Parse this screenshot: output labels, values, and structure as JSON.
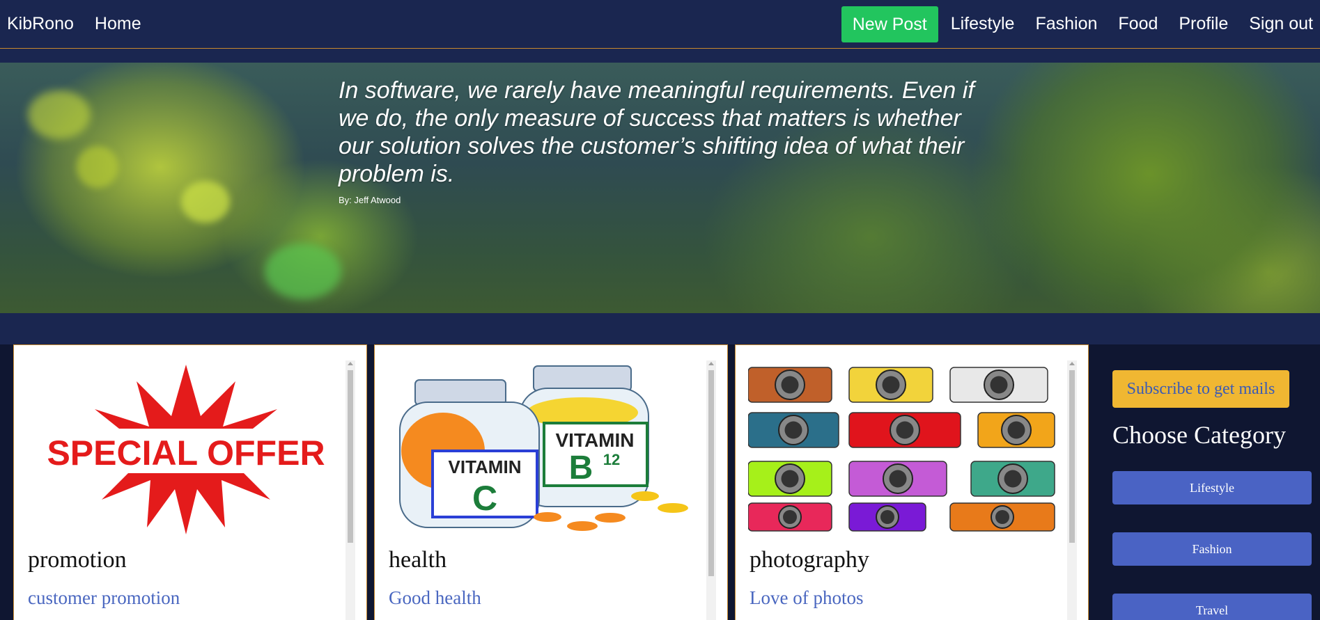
{
  "nav": {
    "brand": "KibRono",
    "home": "Home",
    "new_post": "New Post",
    "links": [
      "Lifestyle",
      "Fashion",
      "Food",
      "Profile",
      "Sign out"
    ]
  },
  "hero": {
    "quote": "In software, we rarely have meaningful requirements. Even if we do, the only measure of success that matters is whether our solution solves the customer’s shifting idea of what their problem is.",
    "author": "By: Jeff Atwood"
  },
  "cards": [
    {
      "title": "promotion",
      "subtitle": "customer promotion",
      "image": "special-offer-image",
      "image_text": "SPECIAL OFFER"
    },
    {
      "title": "health",
      "subtitle": "Good health",
      "image": "vitamin-bottles-image",
      "image_text_1": "VITAMIN",
      "image_text_1b": "C",
      "image_text_2": "VITAMIN",
      "image_text_2b": "B",
      "image_text_2c": "12"
    },
    {
      "title": "photography",
      "subtitle": "Love of photos",
      "image": "cameras-image"
    }
  ],
  "sidebar": {
    "subscribe": "Subscribe to get mails",
    "heading": "Choose Category",
    "categories": [
      "Lifestyle",
      "Fashion",
      "Travel"
    ]
  },
  "colors": {
    "navbar": "#1a2650",
    "accent_green": "#22c55e",
    "subscribe_yellow": "#f0b732",
    "category_blue": "#4a63c4",
    "link_blue": "#4a67c0"
  }
}
